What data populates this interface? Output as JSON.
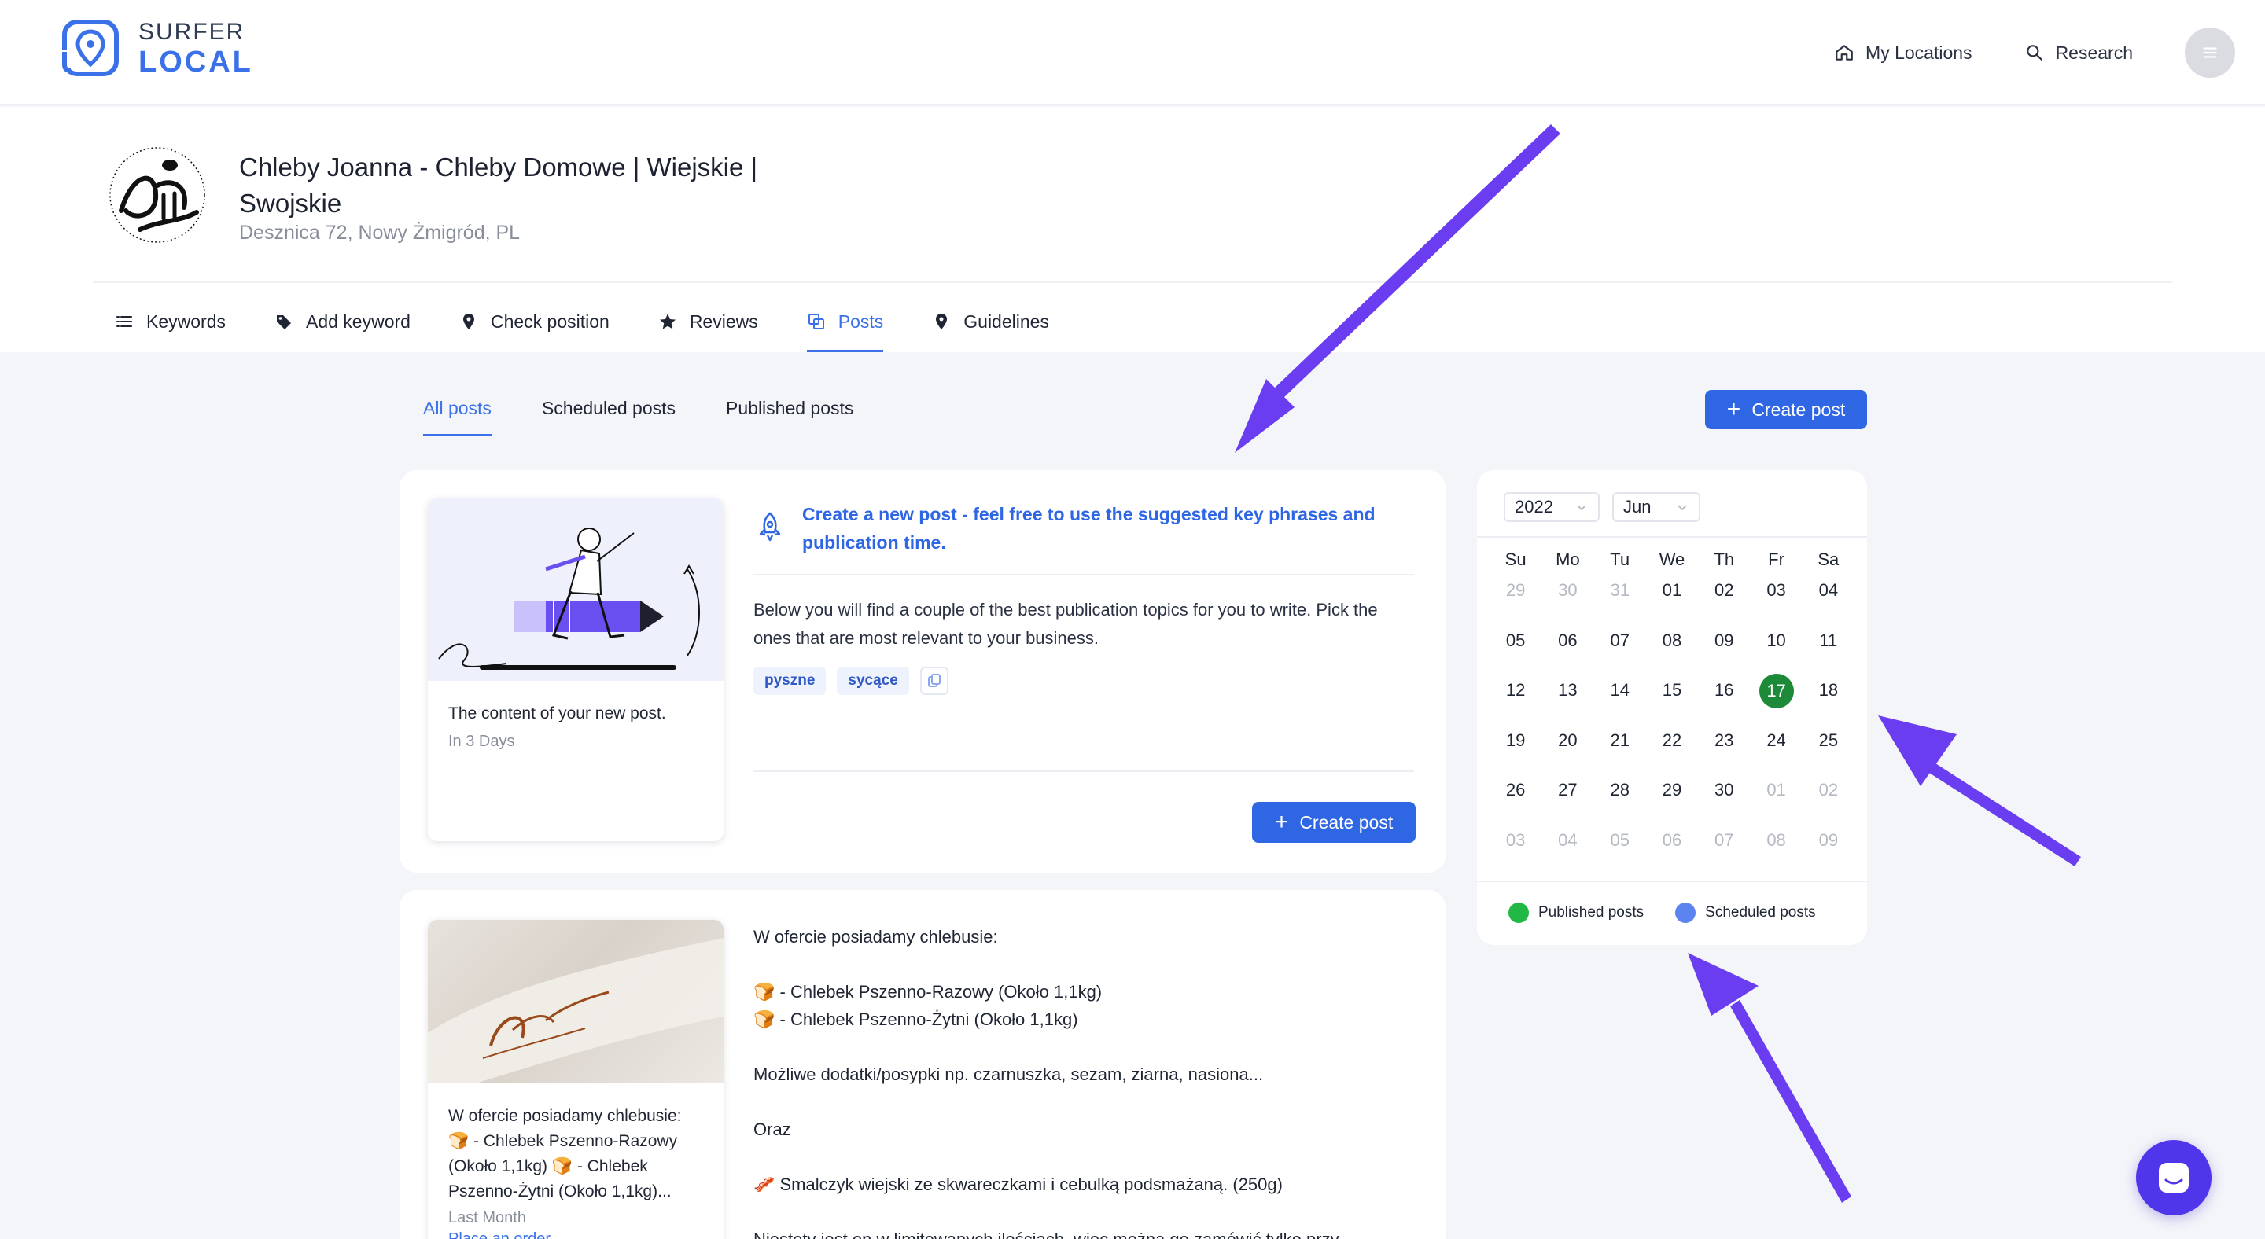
{
  "brand": {
    "line1": "SURFER",
    "line2": "LOCAL"
  },
  "topnav": {
    "locations": "My Locations",
    "research": "Research"
  },
  "business": {
    "name": "Chleby Joanna - Chleby Domowe | Wiejskie | Swojskie",
    "address": "Desznica 72, Nowy Żmigród, PL"
  },
  "tabs": [
    "Keywords",
    "Add keyword",
    "Check position",
    "Reviews",
    "Posts",
    "Guidelines"
  ],
  "subtabs": [
    "All posts",
    "Scheduled posts",
    "Published posts"
  ],
  "create_post": "Create post",
  "suggestion": {
    "title": "Create a new post - feel free to use the suggested key phrases and publication time.",
    "body": "Below you will find a couple of the best publication topics for you to write. Pick the ones that are most relevant to your business.",
    "chips": [
      "pyszne",
      "sycące"
    ],
    "thumb_title": "The content of your new post.",
    "thumb_sub": "In 3 Days"
  },
  "post": {
    "thumb_title": "W ofercie posiadamy chlebusie: 🍞 - Chlebek Pszenno-Razowy (Około 1,1kg) 🍞 - Chlebek Pszenno-Żytni (Około 1,1kg)...",
    "thumb_sub": "Last Month",
    "thumb_link": "Place an order",
    "lines": [
      "W ofercie posiadamy chlebusie:",
      "",
      "🍞 - Chlebek Pszenno-Razowy (Około 1,1kg)",
      "🍞 - Chlebek Pszenno-Żytni (Około 1,1kg)",
      "",
      " Możliwe dodatki/posypki np. czarnuszka, sezam, ziarna, nasiona...",
      "",
      "Oraz",
      "",
      "🥓 Smalczyk wiejski ze skwareczkami i cebulką podsmażaną. (250g)",
      "",
      "Niestety jest on w limitowanych ilościach, więc można go zamówić tylko przy"
    ]
  },
  "calendar": {
    "year": "2022",
    "month": "Jun",
    "weekdays": [
      "Su",
      "Mo",
      "Tu",
      "We",
      "Th",
      "Fr",
      "Sa"
    ],
    "days": [
      [
        "29",
        true
      ],
      [
        "30",
        true
      ],
      [
        "31",
        true
      ],
      [
        "01",
        false
      ],
      [
        "02",
        false
      ],
      [
        "03",
        false
      ],
      [
        "04",
        false
      ],
      [
        "05",
        false
      ],
      [
        "06",
        false
      ],
      [
        "07",
        false
      ],
      [
        "08",
        false
      ],
      [
        "09",
        false
      ],
      [
        "10",
        false
      ],
      [
        "11",
        false
      ],
      [
        "12",
        false
      ],
      [
        "13",
        false
      ],
      [
        "14",
        false
      ],
      [
        "15",
        false
      ],
      [
        "16",
        false
      ],
      [
        "17",
        false
      ],
      [
        "18",
        false
      ],
      [
        "19",
        false
      ],
      [
        "20",
        false
      ],
      [
        "21",
        false
      ],
      [
        "22",
        false
      ],
      [
        "23",
        false
      ],
      [
        "24",
        false
      ],
      [
        "25",
        false
      ],
      [
        "26",
        false
      ],
      [
        "27",
        false
      ],
      [
        "28",
        false
      ],
      [
        "29",
        false
      ],
      [
        "30",
        false
      ],
      [
        "01",
        true
      ],
      [
        "02",
        true
      ],
      [
        "03",
        true
      ],
      [
        "04",
        true
      ],
      [
        "05",
        true
      ],
      [
        "06",
        true
      ],
      [
        "07",
        true
      ],
      [
        "08",
        true
      ],
      [
        "09",
        true
      ]
    ],
    "today": "17",
    "legend": [
      {
        "label": "Published posts",
        "color": "#22b845"
      },
      {
        "label": "Scheduled posts",
        "color": "#5b84f0"
      }
    ]
  },
  "colors": {
    "accent": "#2f66e3",
    "today": "#1d8a3a",
    "arrow": "#6a3df0",
    "chat": "#5036ea"
  }
}
